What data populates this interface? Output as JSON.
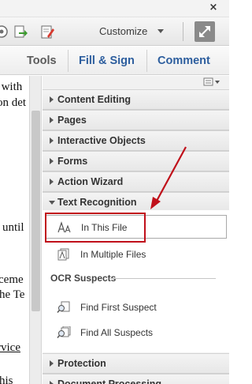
{
  "window": {
    "close_glyph": "×"
  },
  "toolbar": {
    "icons": [
      "round-icon",
      "export-icon",
      "edit-form-icon"
    ],
    "customize_label": "Customize",
    "expand_icon": "expand-icon"
  },
  "tabs": [
    {
      "label": "Tools"
    },
    {
      "label": "Fill & Sign"
    },
    {
      "label": "Comment"
    }
  ],
  "document": {
    "lines": [
      "s with",
      "on det",
      "until",
      "ceme",
      "he Te",
      "rvice",
      "his"
    ]
  },
  "panel": {
    "menu_icon": "panel-options-icon",
    "sections": [
      {
        "label": "Content Editing",
        "expanded": false
      },
      {
        "label": "Pages",
        "expanded": false
      },
      {
        "label": "Interactive Objects",
        "expanded": false
      },
      {
        "label": "Forms",
        "expanded": false
      },
      {
        "label": "Action Wizard",
        "expanded": false
      },
      {
        "label": "Text Recognition",
        "expanded": true
      },
      {
        "label": "Protection",
        "expanded": false
      },
      {
        "label": "Document Processing",
        "expanded": false
      }
    ],
    "text_recognition": {
      "tools": [
        {
          "label": "In This File",
          "icon": "text-aa-icon",
          "highlighted": true
        },
        {
          "label": "In Multiple Files",
          "icon": "multiple-files-icon",
          "highlighted": false
        }
      ],
      "ocr_heading": "OCR Suspects",
      "ocr_tools": [
        {
          "label": "Find First Suspect",
          "icon": "find-suspect-icon"
        },
        {
          "label": "Find All Suspects",
          "icon": "find-all-suspects-icon"
        }
      ]
    }
  },
  "colors": {
    "accent_tab": "#2d5e9e",
    "annotation_red": "#c0101a"
  }
}
